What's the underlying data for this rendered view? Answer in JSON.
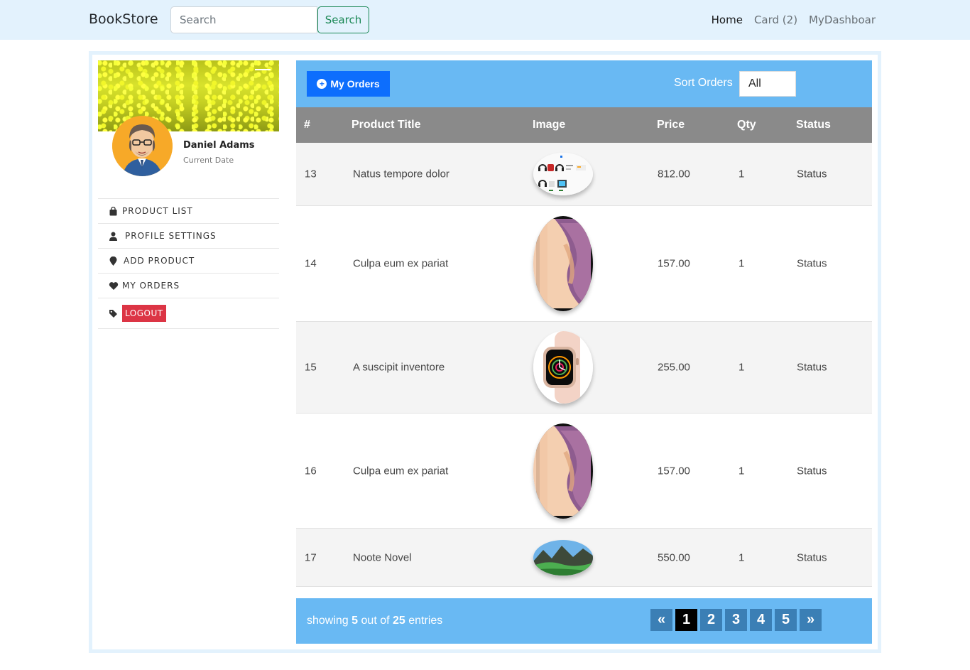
{
  "navbar": {
    "brand": "BookStore",
    "search_placeholder": "Search",
    "search_button": "Search",
    "links": [
      "Home",
      "Card (2)",
      "MyDashboar"
    ]
  },
  "profile": {
    "name": "Daniel Adams",
    "subtitle": "Current Date"
  },
  "sidebar": {
    "items": [
      "PRODUCT LIST",
      "PROFILE SETTINGS",
      "ADD PRODUCT",
      "MY ORDERS"
    ],
    "logout": "LOGOUT"
  },
  "orders": {
    "button": "My Orders",
    "sort_label": "Sort Orders",
    "sort_value": "All",
    "columns": [
      "#",
      "Product Title",
      "Image",
      "Price",
      "Qty",
      "Status"
    ],
    "rows": [
      {
        "id": "13",
        "title": "Natus tempore dolor",
        "image": "headphones-collage",
        "price": "812.00",
        "qty": "1",
        "status": "Status"
      },
      {
        "id": "14",
        "title": "Culpa eum ex pariat",
        "image": "iphone",
        "price": "157.00",
        "qty": "1",
        "status": "Status"
      },
      {
        "id": "15",
        "title": "A suscipit inventore",
        "image": "smartwatch",
        "price": "255.00",
        "qty": "1",
        "status": "Status"
      },
      {
        "id": "16",
        "title": "Culpa eum ex pariat",
        "image": "iphone",
        "price": "157.00",
        "qty": "1",
        "status": "Status"
      },
      {
        "id": "17",
        "title": "Noote Novel",
        "image": "mountain-landscape",
        "price": "550.00",
        "qty": "1",
        "status": "Status"
      }
    ],
    "footer": {
      "showing_prefix": "showing",
      "shown": "5",
      "out_of": "out of",
      "total": "25",
      "suffix": "entries"
    },
    "pages": [
      "«",
      "1",
      "2",
      "3",
      "4",
      "5",
      "»"
    ],
    "active_page": "1"
  },
  "colors": {
    "navbar_bg": "#e3f2fd",
    "panel_accent": "#69b9f3",
    "primary": "#0d6efd",
    "danger": "#dc3545",
    "success": "#198754",
    "table_head": "#8a8a8a"
  }
}
